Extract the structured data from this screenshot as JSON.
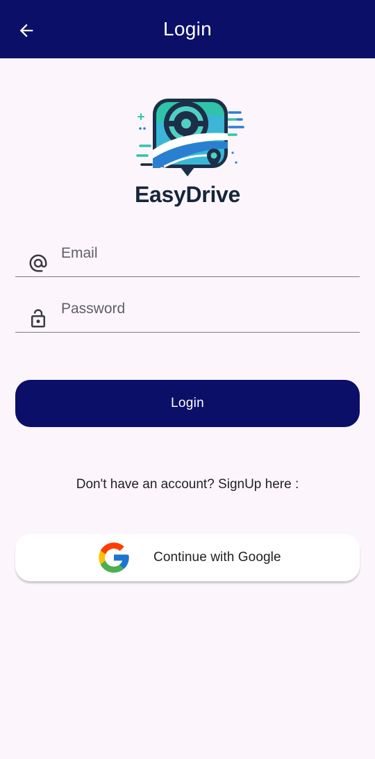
{
  "header": {
    "title": "Login",
    "back_icon": "arrow-left-icon"
  },
  "brand": {
    "name": "EasyDrive",
    "logo_icon": "steering-wheel-road-logo-icon"
  },
  "form": {
    "email": {
      "placeholder": "Email",
      "value": "",
      "icon": "at-sign-icon"
    },
    "password": {
      "placeholder": "Password",
      "value": "",
      "icon": "lock-icon"
    },
    "login_label": "Login"
  },
  "signup": {
    "text": "Don't have an account? SignUp here :"
  },
  "google": {
    "label": "Continue with Google",
    "icon": "google-g-icon"
  },
  "colors": {
    "primary": "#0b0f68",
    "background": "#fcf5fc",
    "brand_text": "#14263a",
    "logo_teal": "#2fc4a8",
    "logo_blue": "#2a7fd0"
  }
}
